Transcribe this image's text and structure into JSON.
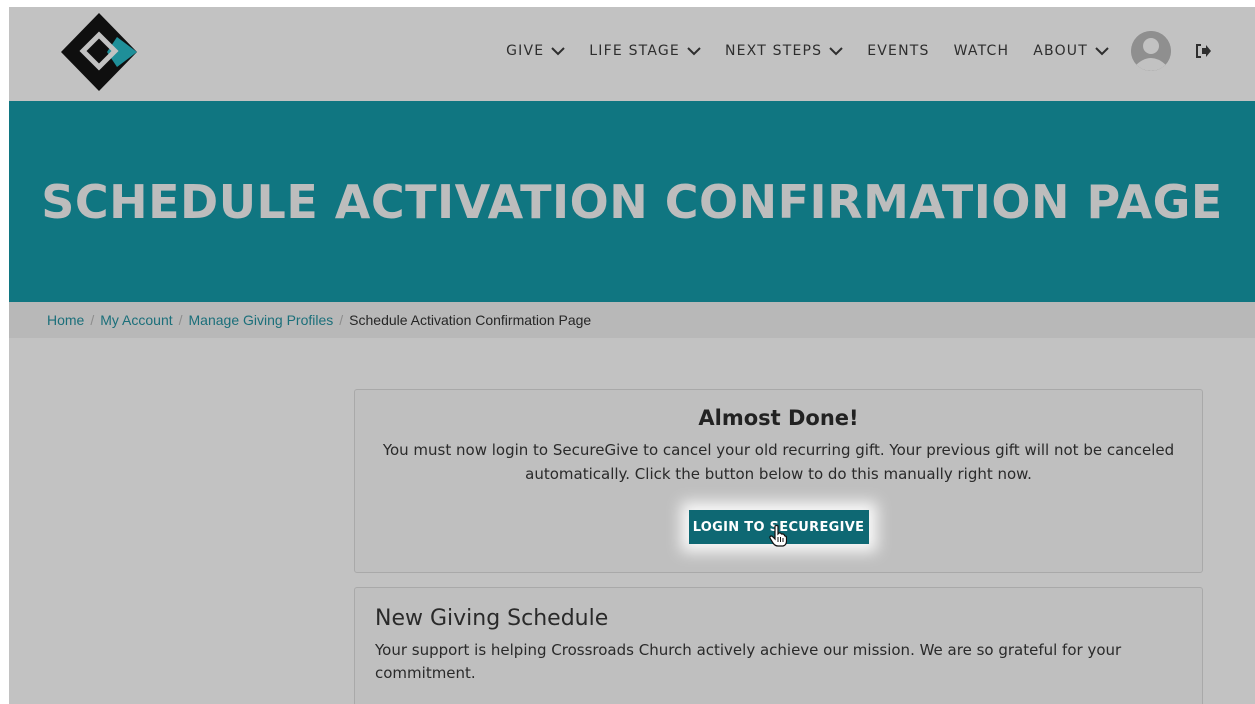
{
  "nav": {
    "items": [
      {
        "label": "GIVE",
        "has_dropdown": true
      },
      {
        "label": "LIFE STAGE",
        "has_dropdown": true
      },
      {
        "label": "NEXT STEPS",
        "has_dropdown": true
      },
      {
        "label": "EVENTS",
        "has_dropdown": false
      },
      {
        "label": "WATCH",
        "has_dropdown": false
      },
      {
        "label": "ABOUT",
        "has_dropdown": true
      }
    ],
    "icons": [
      "logo-icon",
      "chevron-down-icon",
      "user-avatar-icon",
      "logout-icon"
    ]
  },
  "hero": {
    "title": "SCHEDULE ACTIVATION CONFIRMATION PAGE",
    "background_color": "#107681"
  },
  "breadcrumb": {
    "links": [
      "Home",
      "My Account",
      "Manage Giving Profiles"
    ],
    "separator": "/",
    "current": "Schedule Activation Confirmation Page"
  },
  "notice": {
    "title": "Almost Done!",
    "message": "You must now login to SecureGive to cancel your old recurring gift. Your previous gift will not be canceled automatically. Click the button below to do this manually right now.",
    "button_label": "LOGIN TO SECUREGIVE",
    "button_color": "#0e6873"
  },
  "schedule": {
    "title": "New Giving Schedule",
    "message": "Your support is helping Crossroads Church actively achieve our mission. We are so grateful for your commitment."
  }
}
